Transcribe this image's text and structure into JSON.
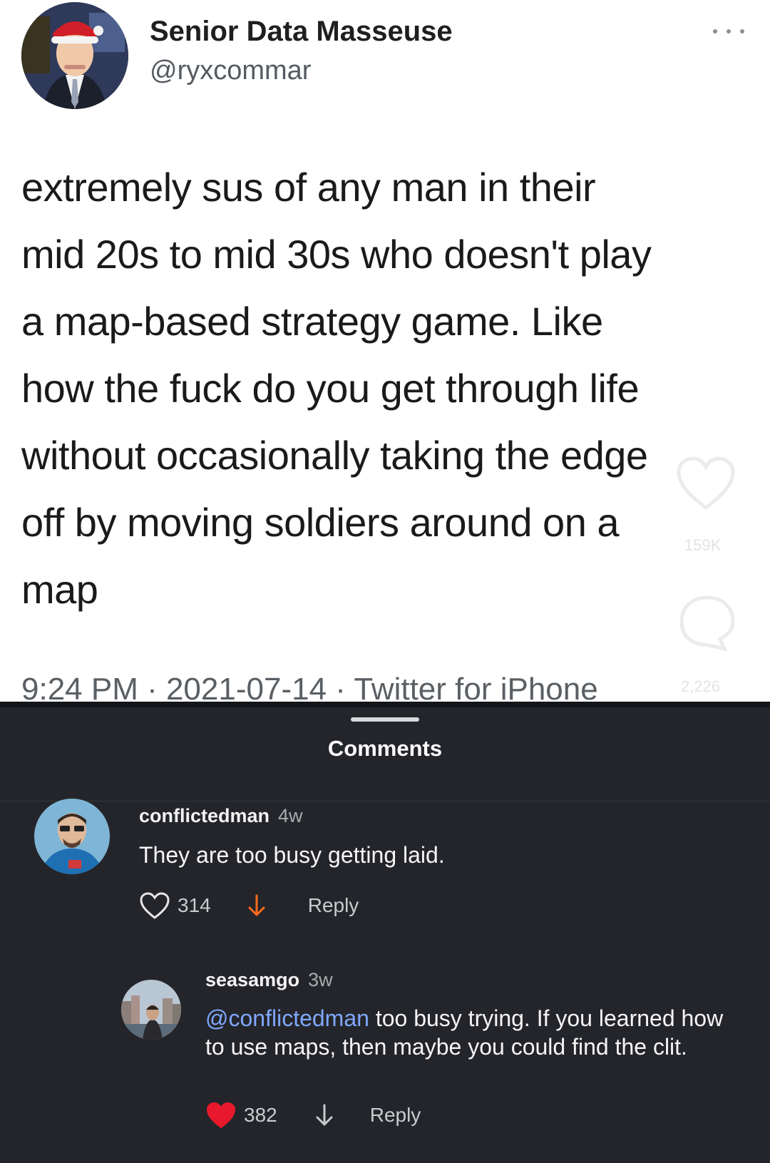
{
  "tweet": {
    "display_name": "Senior Data Masseuse",
    "handle": "@ryxcommar",
    "text_lines": [
      "extremely sus of any man in their",
      "mid 20s to mid 30s who doesn't play",
      "a map-based strategy game. Like",
      "how the fuck do you get through life",
      "without occasionally taking the edge",
      "off by moving soldiers around on a",
      "map"
    ],
    "meta": "9:24 PM · 2021-07-14 · Twitter for iPhone",
    "more_icon": "more-dots-icon"
  },
  "overlay": {
    "like_count": "159K",
    "comment_count": "2,226"
  },
  "comments_sheet": {
    "title": "Comments",
    "comments": [
      {
        "username": "conflictedman",
        "time": "4w",
        "text": "They are too busy getting laid.",
        "mention": "",
        "likes": "314",
        "liked": false,
        "reply_label": "Reply"
      },
      {
        "username": "seasamgo",
        "time": "3w",
        "mention": "@conflictedman",
        "text": " too busy trying. If you learned how to use maps, then maybe you could find the clit.",
        "likes": "382",
        "liked": true,
        "reply_label": "Reply"
      }
    ]
  },
  "colors": {
    "sheet_bg": "#24252a",
    "mention": "#7fa8ff",
    "like_active": "#e8192c",
    "downvote": "#ff6a1a"
  }
}
